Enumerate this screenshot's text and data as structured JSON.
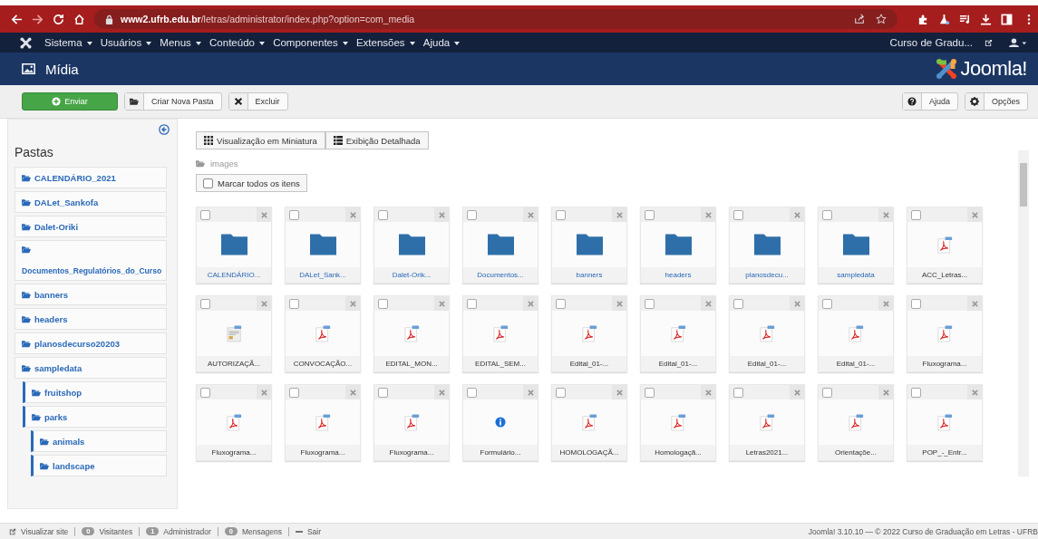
{
  "browser": {
    "url_host": "www2.ufrb.edu.br",
    "url_path": "/letras/administrator/index.php?option=com_media"
  },
  "menu": {
    "items": [
      "Sistema",
      "Usuários",
      "Menus",
      "Conteúdo",
      "Componentes",
      "Extensões",
      "Ajuda"
    ],
    "site_link": "Curso de Gradu..."
  },
  "header": {
    "title": "Mídia",
    "logo_text": "Joomla!"
  },
  "toolbar": {
    "left": [
      {
        "label": "Enviar",
        "kind": "primary"
      },
      {
        "label": "Criar Nova Pasta",
        "kind": "folder"
      },
      {
        "label": "Excluir",
        "kind": "delete"
      }
    ],
    "right": [
      {
        "label": "Ajuda",
        "kind": "help"
      },
      {
        "label": "Opções",
        "kind": "options"
      }
    ]
  },
  "sidebar": {
    "title": "Pastas",
    "folders": [
      {
        "name": "CALENDÁRIO_2021"
      },
      {
        "name": "DALet_Sankofa"
      },
      {
        "name": "Dalet-Oriki"
      },
      {
        "name": "Documentos_Regulatórios_do_Curso"
      },
      {
        "name": "banners"
      },
      {
        "name": "headers"
      },
      {
        "name": "planosdecurso20203"
      },
      {
        "name": "sampledata",
        "children": [
          {
            "name": "fruitshop"
          },
          {
            "name": "parks",
            "children": [
              {
                "name": "animals"
              },
              {
                "name": "landscape"
              }
            ]
          }
        ]
      }
    ]
  },
  "views": [
    {
      "label": "Visualização em Miniatura",
      "kind": "grid"
    },
    {
      "label": "Exibição Detalhada",
      "kind": "list"
    }
  ],
  "breadcrumb": "images",
  "select_all": {
    "label": "Marcar todos os itens",
    "checked": false
  },
  "items": [
    {
      "name": "CALENDÁRIO...",
      "kind": "folder",
      "checked": false
    },
    {
      "name": "DALet_Sank...",
      "kind": "folder",
      "checked": false
    },
    {
      "name": "Dalet-Orik...",
      "kind": "folder",
      "checked": false
    },
    {
      "name": "Documentos...",
      "kind": "folder",
      "checked": false
    },
    {
      "name": "banners",
      "kind": "folder",
      "checked": false
    },
    {
      "name": "headers",
      "kind": "folder",
      "checked": false
    },
    {
      "name": "planosdecu...",
      "kind": "folder",
      "checked": false
    },
    {
      "name": "sampledata",
      "kind": "folder",
      "checked": false
    },
    {
      "name": "ACC_Letras...",
      "kind": "pdf",
      "checked": false
    },
    {
      "name": "AUTORIZAÇÃ...",
      "kind": "document",
      "checked": false
    },
    {
      "name": "CONVOCAÇÃO...",
      "kind": "pdf",
      "checked": false
    },
    {
      "name": "EDITAL_MON...",
      "kind": "pdf",
      "checked": false
    },
    {
      "name": "EDITAL_SEM...",
      "kind": "pdf",
      "checked": false
    },
    {
      "name": "Edital_01-...",
      "kind": "pdf",
      "checked": false
    },
    {
      "name": "Edital_01-...",
      "kind": "pdf",
      "checked": false
    },
    {
      "name": "Edital_01-...",
      "kind": "pdf",
      "checked": false
    },
    {
      "name": "Edital_01-...",
      "kind": "pdf",
      "checked": false
    },
    {
      "name": "Fluxograma...",
      "kind": "pdf",
      "checked": false
    },
    {
      "name": "Fluxograma...",
      "kind": "pdf",
      "checked": false
    },
    {
      "name": "Fluxograma...",
      "kind": "pdf",
      "checked": false
    },
    {
      "name": "Fluxograma...",
      "kind": "pdf",
      "checked": false
    },
    {
      "name": "Formulário...",
      "kind": "info",
      "checked": false
    },
    {
      "name": "HOMOLOGAÇÃ...",
      "kind": "pdf",
      "checked": false
    },
    {
      "name": "Homologaçã...",
      "kind": "pdf",
      "checked": false
    },
    {
      "name": "Letras2021...",
      "kind": "pdf",
      "checked": false
    },
    {
      "name": "Orientaçõe...",
      "kind": "pdf",
      "checked": false
    },
    {
      "name": "POP_-_Entr...",
      "kind": "pdf",
      "checked": false
    }
  ],
  "status_bar": {
    "view_site": "Visualizar site",
    "counters": [
      {
        "count": "0",
        "label": "Visitantes"
      },
      {
        "count": "1",
        "label": "Administrador"
      },
      {
        "count": "0",
        "label": "Mensagens"
      }
    ],
    "logout": "Sair",
    "footer": "Joomla! 3.10.10 — © 2022 Curso de Graduação em Letras - UFRB"
  }
}
